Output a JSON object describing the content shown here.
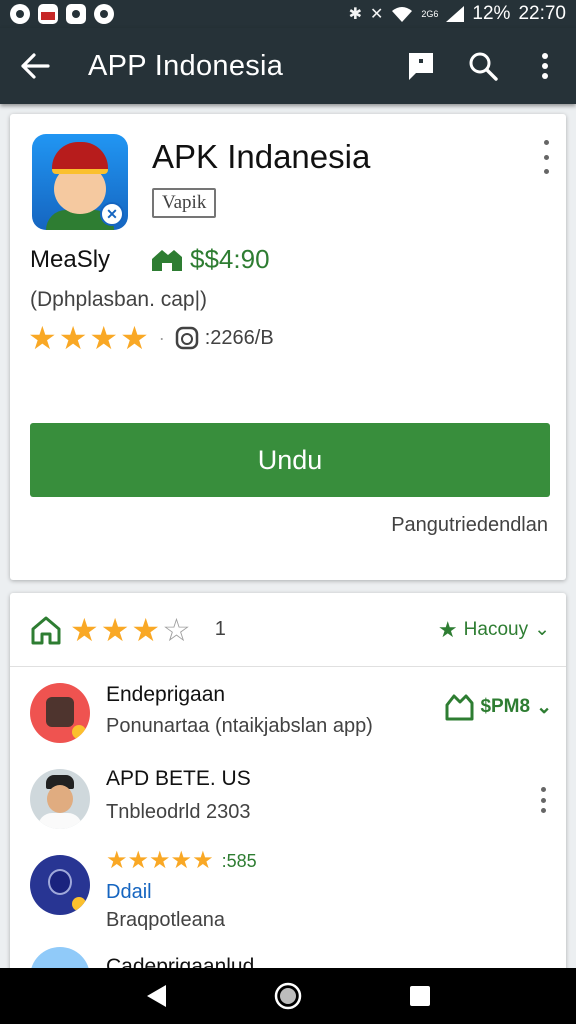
{
  "status_bar": {
    "battery": "12%",
    "time": "22:70",
    "signal_text": "2G6"
  },
  "app_bar": {
    "title": "APP Indonesia",
    "icons": [
      "back-arrow-icon",
      "feedback-icon",
      "search-icon",
      "overflow-menu-icon"
    ]
  },
  "app": {
    "name": "APK Indanesia",
    "tag": "Vapik",
    "developer": "MeaSly",
    "price": "$$4:90",
    "subtitle": "(Dphplasban. cap|)",
    "rating_stars": 4,
    "rating_count": ":2266/B",
    "install_label": "Undu",
    "below_install": "Pangutriedendlan"
  },
  "reviews": {
    "header_stars": 3,
    "header_max_stars": 4,
    "header_count": "1",
    "filter_label": "Hacouy",
    "items": [
      {
        "title": "Endeprigaan",
        "sub": "Ponunartaa (ntaikjabslan app)",
        "price": "$PM8"
      },
      {
        "title": "APD BETE. US",
        "sub": "Tnbleodrld 2303"
      },
      {
        "stars": 5,
        "rating": ":585",
        "link": "Ddail",
        "sub": "Braqpotleana"
      },
      {
        "title": "Cadeprigaanlud"
      }
    ]
  },
  "colors": {
    "appbar": "#263238",
    "accent_green": "#388e3c",
    "price_green": "#2e7d32",
    "star": "#f9a825",
    "link": "#1565c0"
  }
}
